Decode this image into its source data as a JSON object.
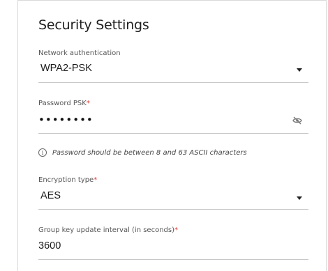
{
  "section_title": "Security Settings",
  "network_auth": {
    "label": "Network authentication",
    "value": "WPA2-PSK"
  },
  "password": {
    "label": "Password PSK",
    "required_mark": "*",
    "masked_value": "••••••••",
    "visibility_icon": "eye-off-icon",
    "hint": "Password should be between 8 and 63 ASCII characters"
  },
  "encryption": {
    "label": "Encryption type",
    "required_mark": "*",
    "value": "AES"
  },
  "group_key": {
    "label": "Group key update interval (in seconds)",
    "required_mark": "*",
    "value": "3600"
  },
  "colors": {
    "required": "#e53935",
    "underline": "#c8c8c8"
  }
}
